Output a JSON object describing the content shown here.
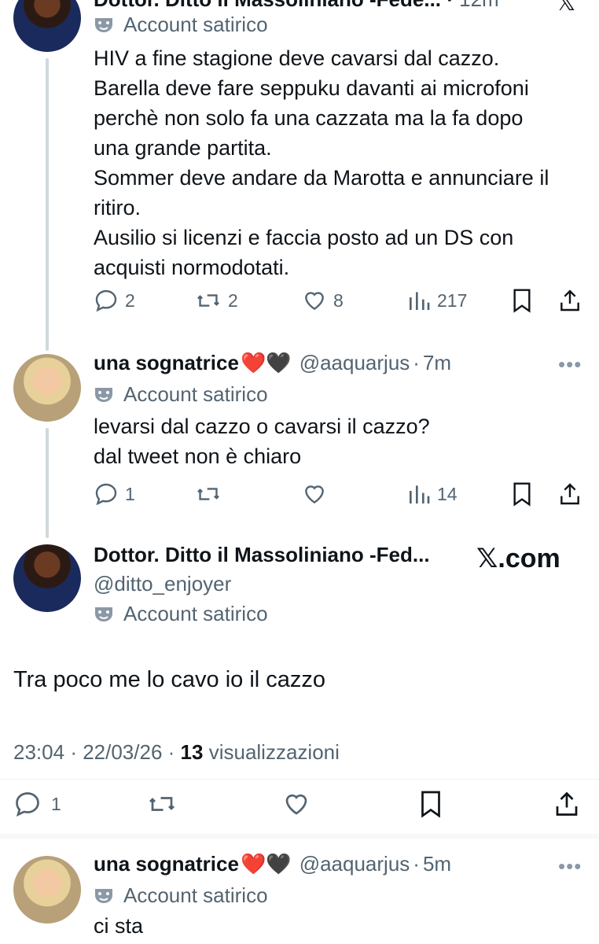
{
  "tweets": [
    {
      "name": "Dottor. Ditto il Massoliniano -Fede...",
      "time": "12m",
      "satirical_label": "Account satirico",
      "lines": [
        "HIV a fine stagione deve cavarsi dal cazzo.",
        "Barella deve fare seppuku davanti ai microfoni",
        "perchè non solo fa una cazzata ma la fa dopo",
        "una grande partita.",
        "Sommer deve andare da Marotta e annunciare il",
        "ritiro.",
        "Ausilio si licenzi e faccia posto ad un DS con",
        "acquisti normodotati."
      ],
      "replies": "2",
      "reposts": "2",
      "likes": "8",
      "views": "217"
    },
    {
      "name": "una sognatrice",
      "emoji": "❤️🖤",
      "handle": "@aaquarjus",
      "time": "7m",
      "satirical_label": "Account satirico",
      "lines": [
        "levarsi dal cazzo o cavarsi il cazzo?",
        "dal tweet non è chiaro"
      ],
      "replies": "1",
      "views": "14"
    }
  ],
  "main": {
    "name": "Dottor. Ditto il Massoliniano -Fed...",
    "handle": "@ditto_enjoyer",
    "satirical_label": "Account satirico",
    "brand": "𝕏.com",
    "text": "Tra poco me lo cavo io il cazzo",
    "time": "23:04",
    "date": "22/03/26",
    "views_count": "13",
    "views_label": "visualizzazioni",
    "replies": "1"
  },
  "reply": {
    "name": "una sognatrice",
    "emoji": "❤️🖤",
    "handle": "@aaquarjus",
    "time": "5m",
    "satirical_label": "Account satirico",
    "text": "ci sta"
  },
  "colors": {
    "text": "#0f1419",
    "secondary": "#536471",
    "thread_line": "#cfd9de"
  }
}
